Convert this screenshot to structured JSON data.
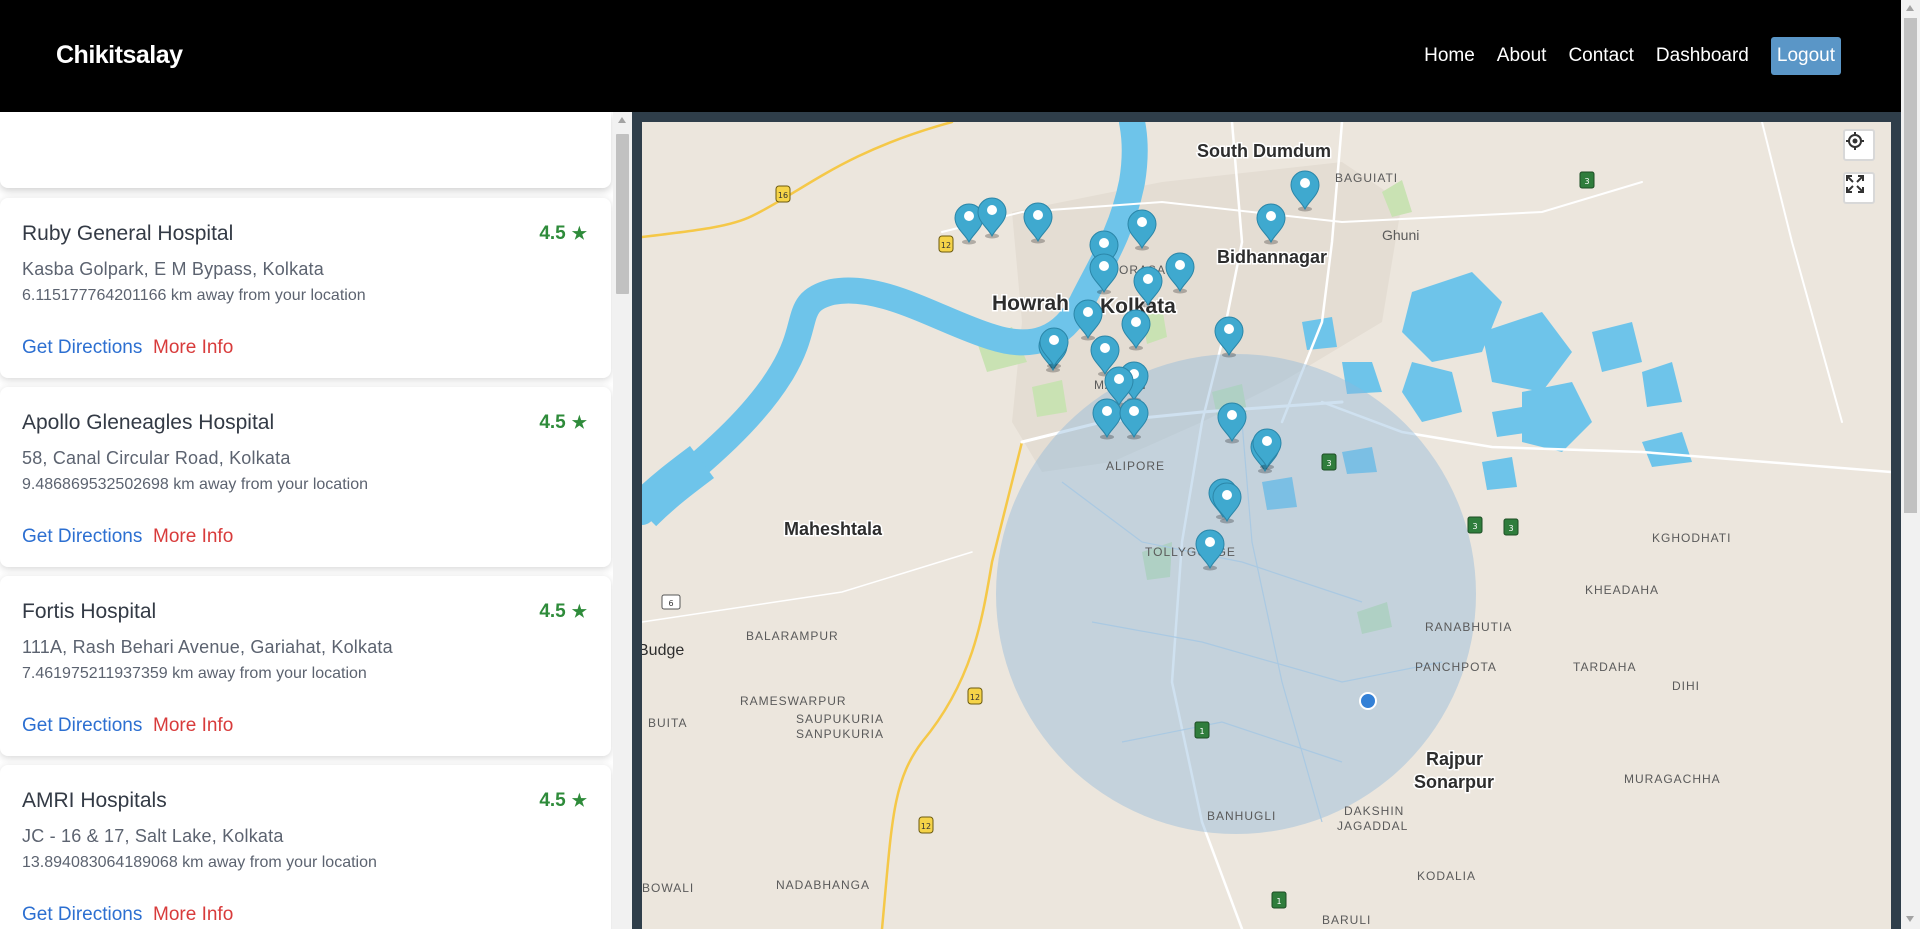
{
  "navbar": {
    "brand": "Chikitsalay",
    "links": [
      "Home",
      "About",
      "Contact",
      "Dashboard"
    ],
    "logout": "Logout"
  },
  "sidebar": {
    "search_placeholder": "",
    "hospitals": [
      {
        "name": "Ruby General Hospital",
        "rating": "4.5",
        "address": "Kasba Golpark, E M Bypass, Kolkata",
        "distance": "6.115177764201166 km away from your location",
        "directions": "Get Directions",
        "more": "More Info"
      },
      {
        "name": "Apollo Gleneagles Hospital",
        "rating": "4.5",
        "address": "58, Canal Circular Road, Kolkata",
        "distance": "9.486869532502698 km away from your location",
        "directions": "Get Directions",
        "more": "More Info"
      },
      {
        "name": "Fortis Hospital",
        "rating": "4.5",
        "address": "111A, Rash Behari Avenue, Gariahat, Kolkata",
        "distance": "7.461975211937359 km away from your location",
        "directions": "Get Directions",
        "more": "More Info"
      },
      {
        "name": "AMRI Hospitals",
        "rating": "4.5",
        "address": "JC - 16 & 17, Salt Lake, Kolkata",
        "distance": "13.894083064189068 km away from your location",
        "directions": "Get Directions",
        "more": "More Info"
      }
    ]
  },
  "map": {
    "labels_major": [
      "South Dumdum",
      "Bidhannagar",
      "Howrah",
      "Kolkata",
      "Maheshtala",
      "Rajpur",
      "Sonarpur"
    ],
    "labels_minor": [
      "BAGUIATI",
      "Ghuni",
      "JORASANKO",
      "MAIDAN",
      "ALIPORE",
      "TOLLYGUNGE",
      "KGHODHATI",
      "KHEADAHA",
      "RANABHUTIA",
      "PANCHPOTA",
      "TARDAHA",
      "DIHI",
      "BALARAMPUR",
      "RAMESWARPUR",
      "SAUPUKURIA",
      "SANPUKURIA",
      "BUITA",
      "Budge",
      "BANHUGLI",
      "DAKSHIN",
      "JAGADDAL",
      "MURAGACHHA",
      "KODALIA",
      "BARULI",
      "BOWALI",
      "NADABHANGA"
    ],
    "road_shields": [
      "16",
      "12",
      "12",
      "12",
      "6",
      "3",
      "3",
      "3",
      "3",
      "1",
      "1"
    ],
    "marker_color": "#3fa9cf",
    "radius_color": "#8db8db",
    "locate_icon": "crosshair-icon",
    "fullscreen_icon": "expand-icon"
  }
}
